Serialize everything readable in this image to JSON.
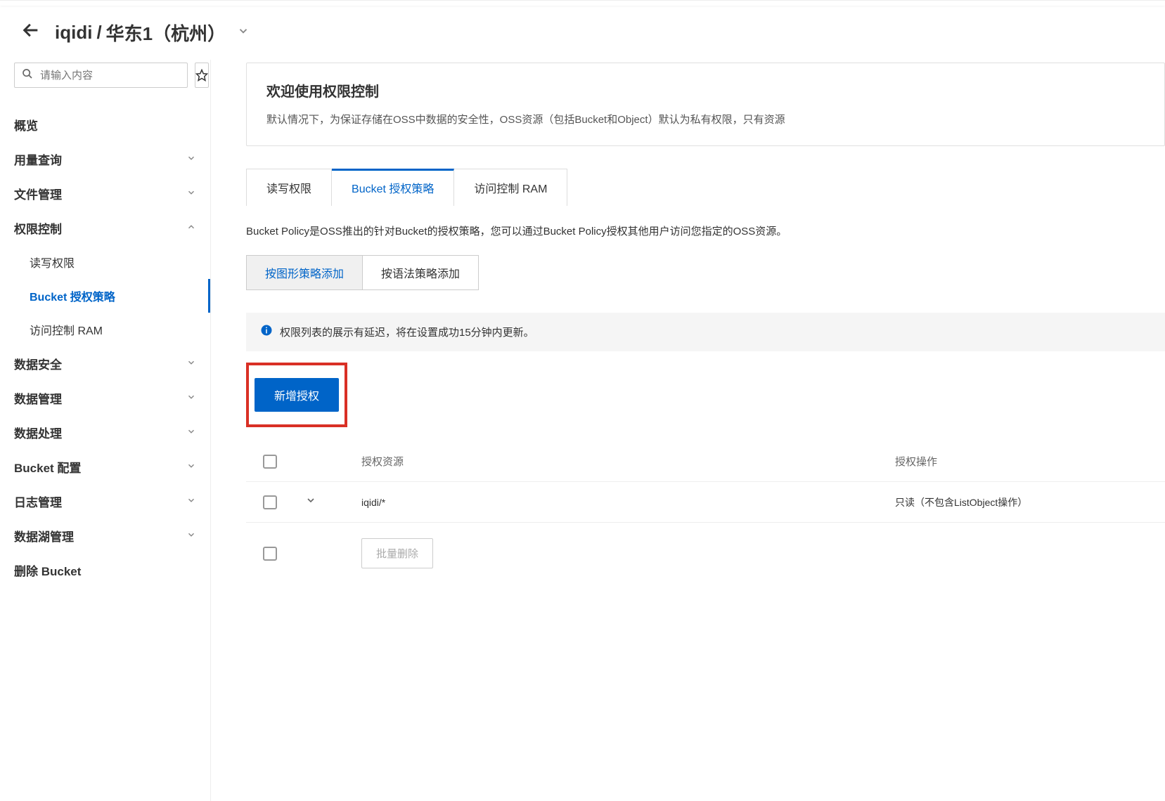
{
  "header": {
    "breadcrumb_bucket": "iqidi",
    "breadcrumb_sep": "/",
    "breadcrumb_region": "华东1（杭州）"
  },
  "sidebar": {
    "search_placeholder": "请输入内容",
    "items": {
      "overview": "概览",
      "usage": "用量查询",
      "files": "文件管理",
      "perm": "权限控制",
      "perm_rw": "读写权限",
      "perm_policy": "Bucket 授权策略",
      "perm_ram": "访问控制 RAM",
      "security": "数据安全",
      "datamgmt": "数据管理",
      "dataprocess": "数据处理",
      "bucketcfg": "Bucket 配置",
      "logs": "日志管理",
      "datalake": "数据湖管理",
      "delete": "删除 Bucket"
    }
  },
  "main": {
    "welcome_title": "欢迎使用权限控制",
    "welcome_text": "默认情况下，为保证存储在OSS中数据的安全性，OSS资源（包括Bucket和Object）默认为私有权限，只有资源",
    "tabs": {
      "rw": "读写权限",
      "policy": "Bucket 授权策略",
      "ram": "访问控制 RAM"
    },
    "policy_desc": "Bucket Policy是OSS推出的针对Bucket的授权策略，您可以通过Bucket Policy授权其他用户访问您指定的OSS资源。",
    "btn_group": {
      "graphical": "按图形策略添加",
      "syntax": "按语法策略添加"
    },
    "info_banner": "权限列表的展示有延迟，将在设置成功15分钟内更新。",
    "add_auth_btn": "新增授权",
    "table": {
      "col_resource": "授权资源",
      "col_action": "授权操作",
      "row1_resource": "iqidi/*",
      "row1_action": "只读（不包含ListObject操作）",
      "bulk_delete": "批量删除"
    }
  }
}
